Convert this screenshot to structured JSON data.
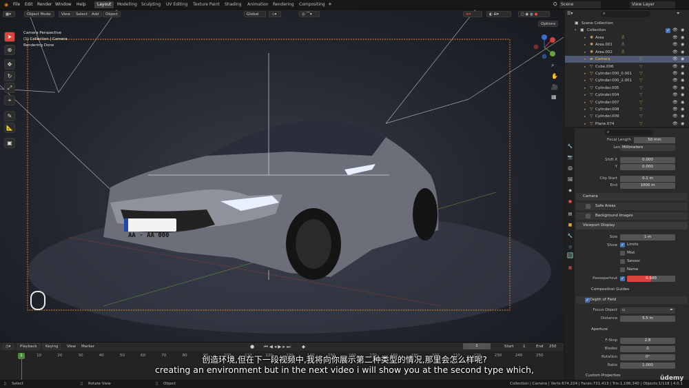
{
  "app": {
    "menus": [
      "File",
      "Edit",
      "Render",
      "Window",
      "Help"
    ],
    "workspaces": [
      "Layout",
      "Modelling",
      "Sculpting",
      "UV Editing",
      "Texture Paint",
      "Shading",
      "Animation",
      "Rendering",
      "Compositing"
    ],
    "active_workspace": "Layout",
    "scene": "Scene",
    "view_layer": "View Layer"
  },
  "viewport": {
    "mode": "Object Mode",
    "menus": [
      "View",
      "Select",
      "Add",
      "Object"
    ],
    "transform": "Global",
    "options": "Options",
    "info": [
      "Camera Perspective",
      "(1) Collection | Camera",
      "Rendering Done"
    ],
    "plate": "AA · AA 000"
  },
  "outliner": {
    "root": "Scene Collection",
    "collection": "Collection",
    "items": [
      "Area",
      "Area.001",
      "Area.002",
      "Camera",
      "Cube.006",
      "Cylinder.000_0.001",
      "Cylinder.000_2.001",
      "Cylinder.005",
      "Cylinder.004",
      "Cylinder.007",
      "Cylinder.008",
      "Cylinder.009",
      "Plane.074"
    ],
    "selected": "Camera"
  },
  "properties": {
    "focal_length_label": "Focal Length",
    "focal_length": "50 mm",
    "lens_unit_label": "Lens Unit",
    "lens_unit": "Millimeters",
    "shift_x_label": "Shift X",
    "shift_x": "0.000",
    "y_label": "Y",
    "y": "0.000",
    "clip_start_label": "Clip Start",
    "clip_start": "0.1 m",
    "end_label": "End",
    "end": "1000 m",
    "sections": {
      "camera": "Camera",
      "safe_areas": "Safe Areas",
      "background_images": "Background Images",
      "viewport_display": "Viewport Display",
      "composition_guides": "Composition Guides",
      "depth_of_field": "Depth of Field",
      "aperture": "Aperture",
      "custom_properties": "Custom Properties"
    },
    "size_label": "Size",
    "size": "1 m",
    "show_label": "Show",
    "show_options": [
      {
        "label": "Limits",
        "checked": true
      },
      {
        "label": "Mist",
        "checked": false
      },
      {
        "label": "Sensor",
        "checked": false
      },
      {
        "label": "Name",
        "checked": false
      }
    ],
    "passepartout_label": "Passepartout",
    "passepartout": "0.500",
    "passepartout_fraction": 0.5,
    "focus_object_label": "Focus Object",
    "distance_label": "Distance",
    "distance": "5.5 m",
    "fstop_label": "F-Stop",
    "fstop": "2.8",
    "blades_label": "Blades",
    "blades": "0",
    "rotation_label": "Rotation",
    "rotation": "0°",
    "ratio_label": "Ratio",
    "ratio": "1.000"
  },
  "timeline": {
    "playback": "Playback",
    "keying": "Keying",
    "view": "View",
    "marker": "Marker",
    "current_frame": "1",
    "start_label": "Start",
    "start": "1",
    "end_label": "End",
    "end": "250",
    "ticks": [
      "1",
      "10",
      "20",
      "30",
      "40",
      "50",
      "60",
      "70",
      "80",
      "90",
      "100",
      "110",
      "120",
      "130",
      "140",
      "150",
      "160",
      "170",
      "180",
      "190",
      "200",
      "210",
      "220",
      "230",
      "240",
      "250"
    ]
  },
  "status": {
    "select": "Select",
    "rotate_view": "Rotate View",
    "object": "Object",
    "stats": "Collection | Camera | Verts:674,224 | Faces:731,413 | Tris:1,196,340 | Objects:1/118 | 4.0.1"
  },
  "subtitles": {
    "zh": "创造环境,但在下一段视频中,我将向你展示第二种类型的情况,那里会怎么样呢?",
    "en": "creating an environment but in the next video i will show you at the second type which,"
  },
  "watermark": "ûdemy",
  "colors": {
    "accent_red": "#d9443d",
    "selected_orange": "#f0a030",
    "camera_frame": "#e08a2e",
    "check_blue": "#4772b3"
  }
}
